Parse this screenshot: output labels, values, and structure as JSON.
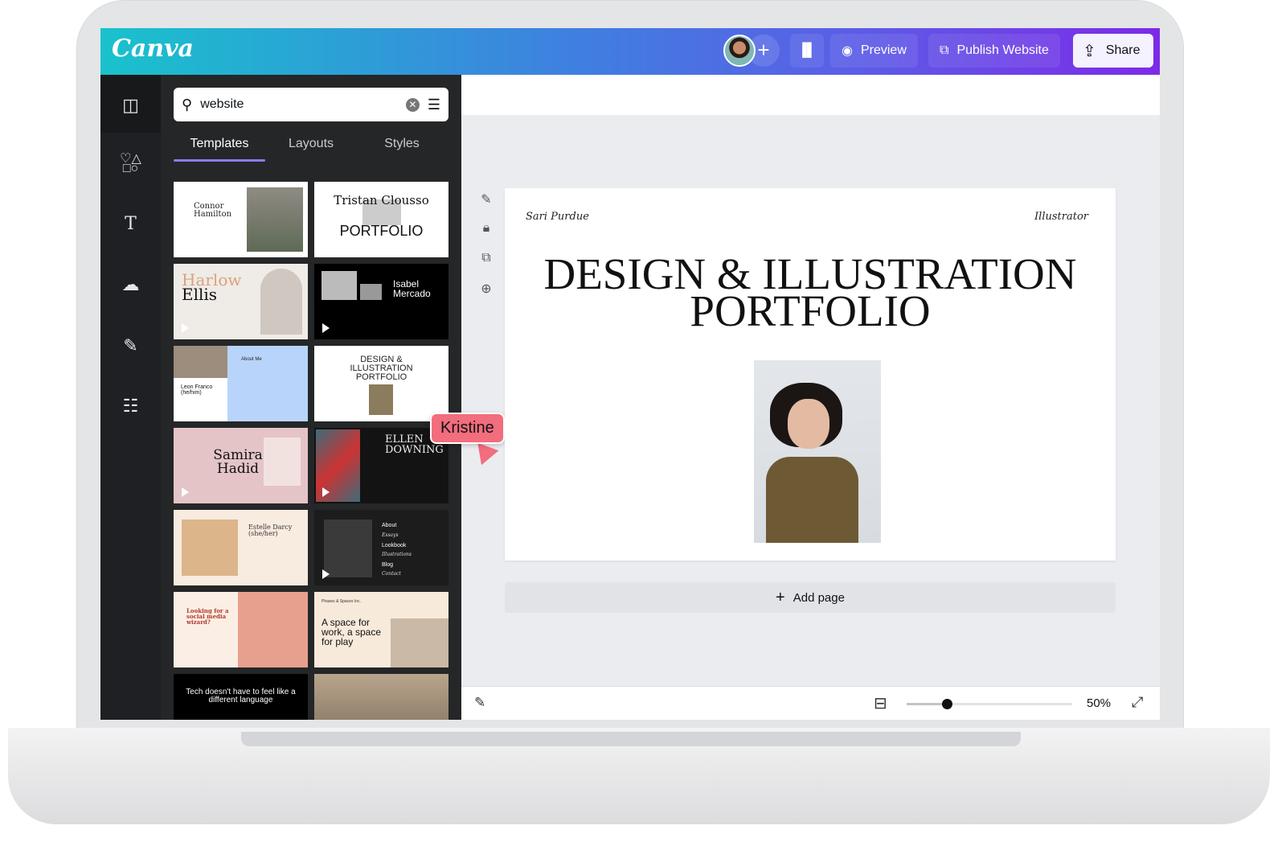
{
  "header": {
    "logo": "Canva",
    "preview": "Preview",
    "publish": "Publish Website",
    "share": "Share",
    "add_collaborator": "+"
  },
  "search": {
    "value": "website",
    "placeholder": "Search"
  },
  "tabs": [
    {
      "label": "Templates",
      "active": true
    },
    {
      "label": "Layouts"
    },
    {
      "label": "Styles"
    }
  ],
  "templates": [
    {
      "title": "Connor Hamilton"
    },
    {
      "title": "Tristan Clousso",
      "subtitle": "PORTFOLIO"
    },
    {
      "title": "Harlow",
      "subtitle": "Ellis"
    },
    {
      "title": "Isabel Mercado"
    },
    {
      "title": "Leon Franco (he/him)",
      "subtitle": "About Me"
    },
    {
      "title": "DESIGN & ILLUSTRATION PORTFOLIO"
    },
    {
      "title": "Samira Hadid"
    },
    {
      "title": "ELLEN DOWNING"
    },
    {
      "title": "Estelle Darcy (she/her)"
    },
    {
      "title": "About",
      "menu": [
        "Essays",
        "Lookbook",
        "Illustrations",
        "Blog",
        "Contact"
      ]
    },
    {
      "title": "Looking for a social media wizard?"
    },
    {
      "title": "A space for work, a space for play",
      "subtitle": "Phases & Spaces Inc."
    },
    {
      "title": "Tech doesn't have to feel like a different language"
    },
    {
      "title": ""
    }
  ],
  "collaborator_cursor": {
    "name": "Kristine",
    "color": "#f26d7d"
  },
  "canvas": {
    "author": "Sari Purdue",
    "role": "Illustrator",
    "title": "DESIGN & ILLUSTRATION PORTFOLIO",
    "add_page": "Add page"
  },
  "footer": {
    "zoom": "50%",
    "zoom_value": 50
  },
  "colors": {
    "brand_gradient_start": "#19c2cc",
    "brand_gradient_end": "#7d2ae8",
    "panel": "#252627",
    "accent": "#8b7cf0"
  }
}
